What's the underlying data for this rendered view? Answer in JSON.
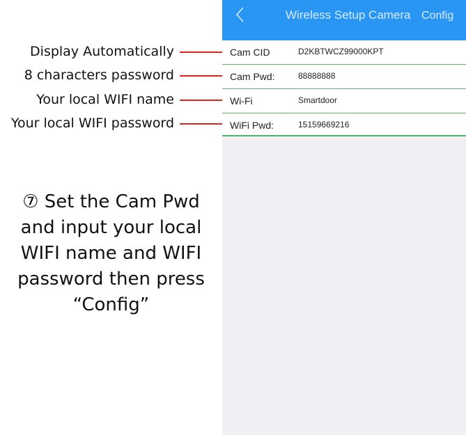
{
  "annotations": [
    "Display Automatically",
    "8 characters password",
    "Your local WIFI name",
    "Your local WIFI password"
  ],
  "instruction_lines": [
    "⑦ Set the Cam Pwd",
    "and input your local",
    "WIFI name and WIFI",
    "password then press",
    "“Config”"
  ],
  "navbar": {
    "back_icon": "chevron-left-icon",
    "title": "Wireless Setup Camera",
    "config_label": "Config"
  },
  "form": {
    "rows": [
      {
        "label": "Cam CID",
        "value": "D2KBTWCZ99000KPT"
      },
      {
        "label": "Cam Pwd:",
        "value": "88888888"
      },
      {
        "label": "Wi-Fi",
        "value": "Smartdoor"
      },
      {
        "label": "WiFi Pwd:",
        "value": "15159669216"
      }
    ]
  },
  "colors": {
    "navbar": "#2a96f3",
    "separator": "#55b86a",
    "leader_line": "#e2231a",
    "screen_background": "#efeff4"
  }
}
